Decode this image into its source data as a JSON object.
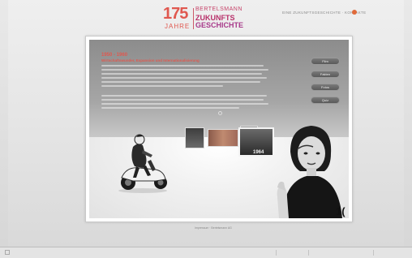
{
  "header": {
    "logo_number": "175",
    "logo_jahre": "JAHRE",
    "logo_brand": "BERTELSMANN",
    "logo_line1": "ZUKUNFTS",
    "logo_line2": "GESCHICHTE",
    "top_link": "EINE ZUKUNFTSGESCHICHTE · KONTAKTE"
  },
  "content": {
    "era_title": "1950 - 1960",
    "era_subtitle": "Wirtschaftswunder, Expansion und Internationalisierung"
  },
  "nav_buttons": [
    {
      "label": "Film"
    },
    {
      "label": "Fakten"
    },
    {
      "label": "Fotos"
    },
    {
      "label": "Quiz"
    }
  ],
  "photo_year": "1964",
  "corner_digit": "1(",
  "footer": {
    "text": "Impressum · Bertelsmann AG"
  },
  "colors": {
    "accent": "#e0584f",
    "brand_purple": "#a83a8a"
  }
}
